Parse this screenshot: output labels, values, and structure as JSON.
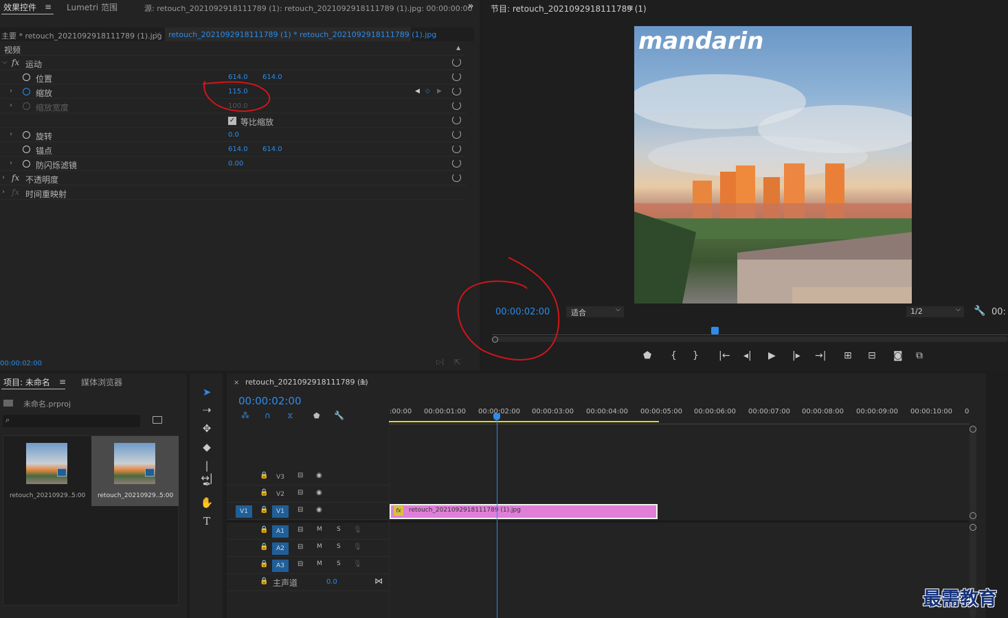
{
  "effect_controls": {
    "tabs": [
      "效果控件",
      "Lumetri 范围",
      "源: retouch_2021092918111789 (1): retouch_2021092918111789 (1).jpg: 00:00:00:00"
    ],
    "more": "»",
    "master_clip": "主要 * retouch_2021092918111789 (1).jpg",
    "seq_clip": "retouch_2021092918111789 (1) * retouch_2021092918111789 (1).jpg",
    "section_video": "视频",
    "motion": "运动",
    "position": {
      "label": "位置",
      "x": "614.0",
      "y": "614.0"
    },
    "scale": {
      "label": "缩放",
      "value": "115.0"
    },
    "scale_width": {
      "label": "缩放宽度",
      "value": "100.0"
    },
    "uniform_scale": "等比缩放",
    "rotation": {
      "label": "旋转",
      "value": "0.0"
    },
    "anchor": {
      "label": "锚点",
      "x": "614.0",
      "y": "614.0"
    },
    "flicker": {
      "label": "防闪烁滤镜",
      "value": "0.00"
    },
    "opacity": "不透明度",
    "time_remap": "时间重映射",
    "timecode": "00:00:02:00"
  },
  "program": {
    "title": "节目: retouch_2021092918111789 (1)",
    "watermark": "mandarin",
    "timecode": "00:00:02:00",
    "fit": "适合",
    "res": "1/2",
    "end_tc": "00:"
  },
  "project": {
    "tabs": [
      "项目: 未命名",
      "媒体浏览器"
    ],
    "file": "未命名.prproj",
    "items": [
      {
        "name": "retouch_20210929...",
        "dur": "5:00"
      },
      {
        "name": "retouch_20210929...",
        "dur": "5:00"
      }
    ]
  },
  "timeline": {
    "title": "retouch_2021092918111789 (1)",
    "timecode": "00:00:02:00",
    "ruler": [
      ":00:00",
      "00:00:01:00",
      "00:00:02:00",
      "00:00:03:00",
      "00:00:04:00",
      "00:00:05:00",
      "00:00:06:00",
      "00:00:07:00",
      "00:00:08:00",
      "00:00:09:00",
      "00:00:10:00",
      "0"
    ],
    "tracks_v": [
      "V3",
      "V2",
      "V1"
    ],
    "src_v": "V1",
    "tracks_a": [
      "A1",
      "A2",
      "A3"
    ],
    "mix": {
      "label": "主声道",
      "value": "0.0"
    },
    "clip": "retouch_2021092918111789 (1).jpg",
    "clip_color": "#e07fd8",
    "m": "M",
    "s": "S"
  },
  "brand": "最需教育",
  "colors": {
    "accent": "#2d8ceb",
    "annotation": "#d0161a"
  }
}
